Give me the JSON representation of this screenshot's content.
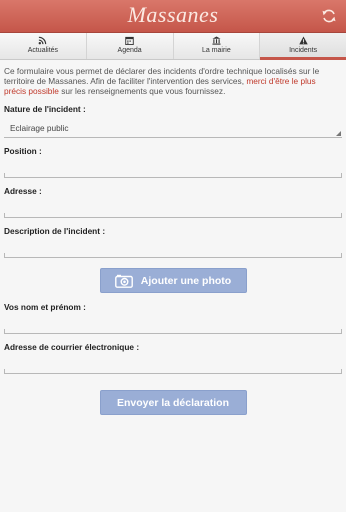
{
  "header": {
    "title": "Massanes",
    "refresh_icon": "refresh-icon"
  },
  "tabs": [
    {
      "label": "Actualités",
      "icon": "rss-icon"
    },
    {
      "label": "Agenda",
      "icon": "calendar-icon"
    },
    {
      "label": "La mairie",
      "icon": "town-hall-icon"
    },
    {
      "label": "Incidents",
      "icon": "warning-icon",
      "active": true
    }
  ],
  "intro": {
    "text": "Ce formulaire vous permet de déclarer des incidents d'ordre technique localisés sur le territoire de Massanes. Afin de faciliter l'intervention des services, ",
    "highlight": "merci d'être le plus précis possible",
    "tail": " sur les renseignements que vous fournissez."
  },
  "form": {
    "nature_label": "Nature de l'incident :",
    "nature_value": "Eclairage public",
    "position_label": "Position :",
    "position_value": "",
    "address_label": "Adresse :",
    "address_value": "",
    "description_label": "Description de l'incident :",
    "description_value": "",
    "photo_button": "Ajouter une photo",
    "name_label": "Vos nom et prénom :",
    "name_value": "",
    "email_label": "Adresse de courrier électronique :",
    "email_value": "",
    "submit_button": "Envoyer la déclaration"
  },
  "colors": {
    "header": "#c5564a",
    "button": "#9aaed6",
    "highlight": "#c0392b"
  }
}
